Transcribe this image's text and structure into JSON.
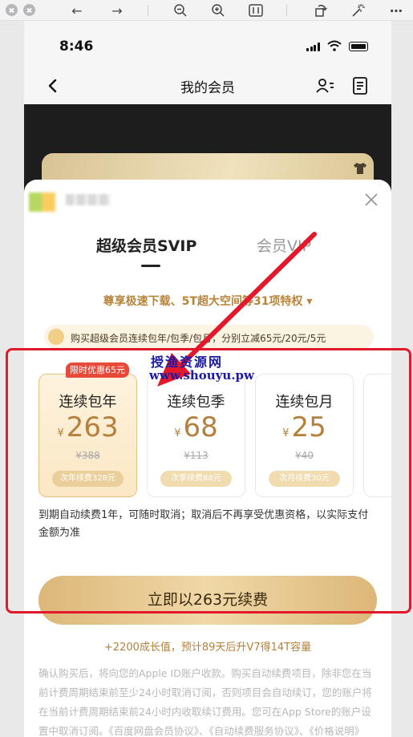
{
  "phone": {
    "time": "8:46"
  },
  "nav": {
    "title": "我的会员"
  },
  "tabs": [
    {
      "label": "超级会员SVIP"
    },
    {
      "label": "会员VIP"
    }
  ],
  "privilege": "尊享极速下载、5T超大空间等31项特权",
  "promo": "购买超级会员连续包年/包季/包月，分别立减65元/20元/5元",
  "plans": [
    {
      "badge": "限时优惠65元",
      "name": "连续包年",
      "currency": "¥",
      "price": "263",
      "original": "¥388",
      "renew": "次年续费328元",
      "selected": true
    },
    {
      "name": "连续包季",
      "currency": "¥",
      "price": "68",
      "original": "¥113",
      "renew": "次季续费88元"
    },
    {
      "name": "连续包月",
      "currency": "¥",
      "price": "25",
      "original": "¥40",
      "renew": "次月续费30元"
    }
  ],
  "renew_note": "到期自动续费1年，可随时取消；取消后不再享受优惠资格，以实际支付金额为准",
  "cta": "立即以263元续费",
  "growth": "+2200成长值，预计89天后升V7得14T容量",
  "legal": "确认购买后，将向您的Apple ID账户收款。购买自动续费项目，除非您在当前计费周期结束前至少24小时取消订阅，否则项目会自动续订，您的账户将在当前计费周期结束前24小时内收取续订费用。您可在App Store的账户设置中取消订阅。《百度网盘会员协议》、《自动续费服务协议》、《价格说明》",
  "watermark": {
    "line1": "授渔资源网",
    "line2": "www.shouyu.pw"
  },
  "colors": {
    "accent_gold": "#b5803a",
    "annotation_red": "#e3182b",
    "badge_red": "#e84a3a"
  }
}
